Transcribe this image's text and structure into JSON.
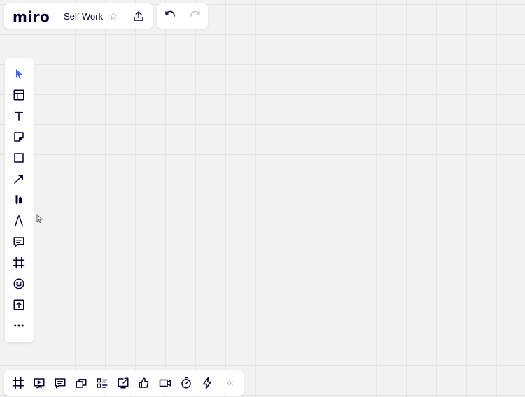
{
  "header": {
    "logo": "miro",
    "board_name": "Self Work",
    "icons": {
      "star": "star-icon",
      "share": "upload-icon"
    }
  },
  "history": {
    "undo": "undo-icon",
    "redo": "redo-icon",
    "redo_enabled": false
  },
  "left_toolbar": {
    "tools": [
      "select",
      "templates",
      "text",
      "sticky-note",
      "shape",
      "connection-line",
      "pen-markers",
      "pen",
      "comment",
      "frame",
      "emoji",
      "upload",
      "more"
    ]
  },
  "bottom_toolbar": {
    "tools": [
      "frames",
      "presentation",
      "comments",
      "cards",
      "outline",
      "screen-share",
      "voting",
      "video-chat",
      "timer",
      "actions",
      "collapse"
    ]
  },
  "colors": {
    "accent": "#4262ff",
    "ink": "#050038",
    "disabled": "#c3c3cc",
    "canvas": "#f2f2f2",
    "grid": "#e4e4e4"
  }
}
